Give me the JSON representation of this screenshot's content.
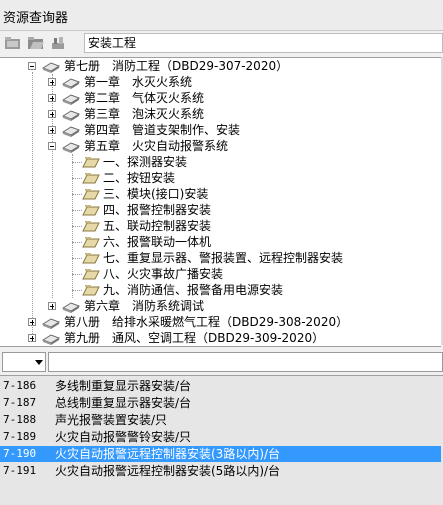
{
  "window": {
    "title": "资源查询器"
  },
  "toolbar": {
    "search_value": "安装工程",
    "expand_label": "+",
    "collapse_label": "-"
  },
  "tree": {
    "volume7": {
      "label": "第七册　消防工程（DBD29-307-2020）",
      "chapters": [
        {
          "label": "第一章　水灭火系统",
          "expanded": false
        },
        {
          "label": "第二章　气体灭火系统",
          "expanded": false
        },
        {
          "label": "第三章　泡沫灭火系统",
          "expanded": false
        },
        {
          "label": "第四章　管道支架制作、安装",
          "expanded": false
        },
        {
          "label": "第五章　火灾自动报警系统",
          "expanded": true
        }
      ],
      "sections": [
        "一、探测器安装",
        "二、按钮安装",
        "三、模块(接口)安装",
        "四、报警控制器安装",
        "五、联动控制器安装",
        "六、报警联动一体机",
        "七、重复显示器、警报装置、远程控制器安装",
        "八、火灾事故广播安装",
        "九、消防通信、报警备用电源安装"
      ],
      "chapter6": "第六章　消防系统调试"
    },
    "volume8": "第八册　给排水采暖燃气工程（DBD29-308-2020）",
    "volume9": "第九册　通风、空调工程（DBD29-309-2020）"
  },
  "filter": {
    "value": ""
  },
  "items": [
    {
      "code": "7-186",
      "name": "多线制重复显示器安装/台"
    },
    {
      "code": "7-187",
      "name": "总线制重复显示器安装/台"
    },
    {
      "code": "7-188",
      "name": "声光报警装置安装/只"
    },
    {
      "code": "7-189",
      "name": "火灾自动报警警铃安装/只"
    },
    {
      "code": "7-190",
      "name": "火灾自动报警远程控制器安装(3路以内)/台"
    },
    {
      "code": "7-191",
      "name": "火灾自动报警远程控制器安装(5路以内)/台"
    }
  ],
  "selected_code": "7-190",
  "colors": {
    "selection": "#3399ff",
    "list_bg": "#e6e6e6"
  }
}
